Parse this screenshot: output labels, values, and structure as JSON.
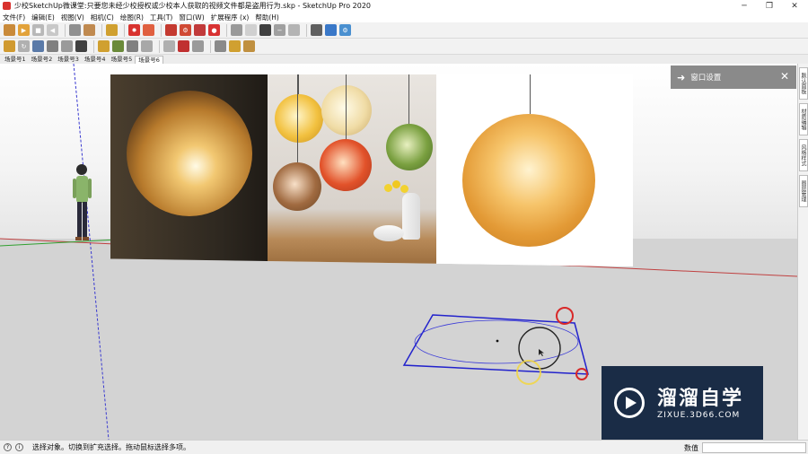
{
  "window": {
    "title": "少校SketchUp微课堂:只要您未经少校授权或少校本人获取的视频文件都是盗用行为.skp - SketchUp Pro 2020",
    "minimize_icon": "minimize-icon",
    "maximize_icon": "restore-icon",
    "close_icon": "close-icon"
  },
  "menubar": {
    "items": [
      "文件(F)",
      "编辑(E)",
      "视图(V)",
      "相机(C)",
      "绘图(R)",
      "工具(T)",
      "窗口(W)",
      "扩展程序 (x)",
      "帮助(H)"
    ]
  },
  "scene_tabs": {
    "items": [
      "场景号1",
      "场景号2",
      "场景号3",
      "场景号4",
      "场景号5",
      "场景号6"
    ],
    "active_index": 5
  },
  "tray": {
    "title": "窗口设置",
    "arrow_icon": "arrow-right-icon",
    "close_icon": "close-icon"
  },
  "side_tabs": {
    "items": [
      "默认面板",
      "材质编辑",
      "风格样式",
      "图层管理"
    ]
  },
  "logo": {
    "brand": "溜溜自学",
    "url": "ZIXUE.3D66.COM"
  },
  "status": {
    "message": "选择对象。切换到扩充选择。拖动鼠标选择多项。",
    "measurements_label": "数值",
    "measurements_value": ""
  },
  "colors": {
    "accent_red": "#d8322e",
    "selection_blue": "#2222cc",
    "axis_red": "#c04040",
    "axis_green": "#30a030",
    "axis_blue": "#3030c0",
    "logo_bg": "#1a2c46"
  }
}
